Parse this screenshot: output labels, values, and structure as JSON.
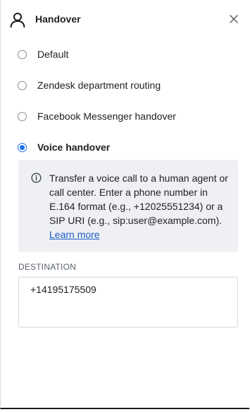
{
  "header": {
    "title": "Handover",
    "icon": "user-icon",
    "close_icon": "close-icon"
  },
  "options": [
    {
      "label": "Default",
      "selected": false
    },
    {
      "label": "Zendesk department routing",
      "selected": false
    },
    {
      "label": "Facebook Messenger handover",
      "selected": false
    },
    {
      "label": "Voice handover",
      "selected": true
    }
  ],
  "info": {
    "icon": "info-icon",
    "text": "Transfer a voice call to a human agent or call center. Enter a phone number in E.164 format (e.g., +12025551234) or a SIP URI (e.g., sip:user@example.com).",
    "link_label": "Learn more"
  },
  "destination": {
    "label": "DESTINATION",
    "value": "+14195175509"
  },
  "colors": {
    "accent": "#1f6feb",
    "link": "#1f5ec4",
    "info_bg": "#eef0f4"
  }
}
